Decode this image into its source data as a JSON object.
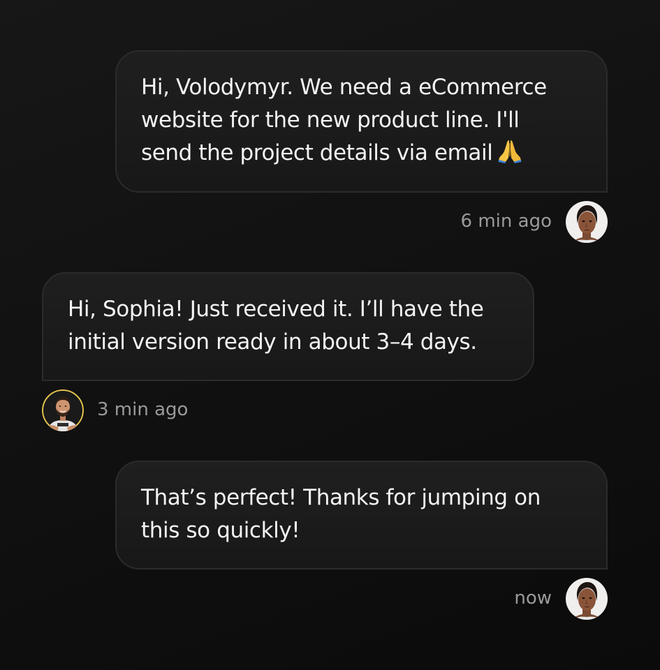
{
  "conversation": {
    "messages": [
      {
        "sender": "Sophia",
        "direction": "outgoing",
        "text": "Hi, Volodymyr. We need a eCommerce\nwebsite for the new product line. I'll\nsend the project details via email",
        "emoji": "folded-hands-icon",
        "time": "6 min ago"
      },
      {
        "sender": "Volodymyr",
        "direction": "incoming",
        "text": "Hi, Sophia! Just received it. I’ll have the\ninitial version ready in about 3–4 days.",
        "time": "3 min ago"
      },
      {
        "sender": "Sophia",
        "direction": "outgoing",
        "text": "That’s perfect! Thanks for jumping on\nthis so quickly!",
        "time": "now"
      }
    ]
  },
  "colors": {
    "background": "#111111",
    "bubble": "#1c1c1c",
    "bubble_border": "#2b2b2b",
    "text": "#f4f4f4",
    "timestamp": "#9a9a9a"
  }
}
